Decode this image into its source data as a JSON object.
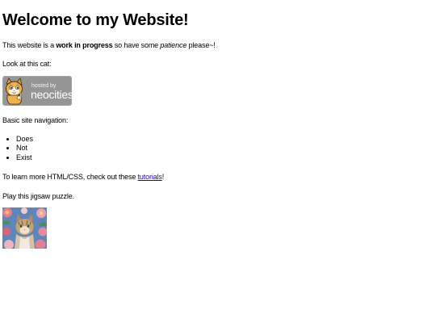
{
  "page": {
    "heading": "Welcome to my Website!",
    "intro": {
      "before": "This website is a ",
      "bold": "work in progress",
      "middle": " so have some ",
      "italic": "patience",
      "after": " please~!"
    },
    "cat_label": "Look at this cat:",
    "badge": {
      "line1": "hosted by",
      "line2": "neocities"
    },
    "nav_label": "Basic site navigation:",
    "nav_items": [
      "Does",
      "Not",
      "Exist"
    ],
    "learn": {
      "before": "To learn more HTML/CSS, check out these ",
      "link": "tutorials",
      "after": "!"
    },
    "puzzle_label": "Play this jigsaw puzzle.",
    "colors": {
      "link": "#1a0dab",
      "badge_bg": "#9c9c9c",
      "cat_orange": "#e8a13a"
    }
  }
}
